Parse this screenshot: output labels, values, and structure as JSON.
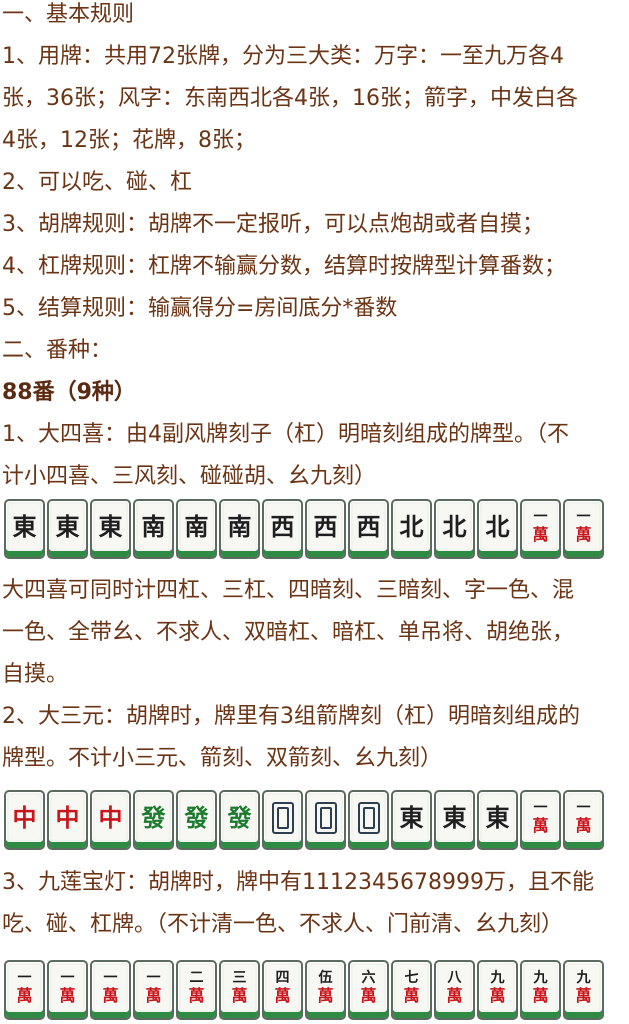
{
  "text_lines": [
    "一、基本规则",
    "1、用牌：共用72张牌，分为三大类：万字：一至九万各4",
    "张，36张；风字：东南西北各4张，16张；箭字，中发白各",
    "4张，12张；花牌，8张；",
    "2、可以吃、碰、杠",
    "3、胡牌规则：胡牌不一定报听，可以点炮胡或者自摸；",
    "4、杠牌规则：杠牌不输赢分数，结算时按牌型计算番数；",
    "5、结算规则：输赢得分=房间底分*番数",
    "二、番种：",
    "88番（9种）",
    "1、大四喜：由4副风牌刻子（杠）明暗刻组成的牌型。（不",
    "计小四喜、三风刻、碰碰胡、幺九刻）",
    "大四喜可同时计四杠、三杠、四暗刻、三暗刻、字一色、混",
    "一色、全带幺、不求人、双暗杠、暗杠、单吊将、胡绝张，",
    "自摸。",
    "2、大三元：胡牌时，牌里有3组箭牌刻（杠）明暗刻组成的",
    "牌型。不计小三元、箭刻、双箭刻、幺九刻）",
    "3、九莲宝灯：胡牌时，牌中有1112345678999万，且不能",
    "吃、碰、杠牌。（不计清一色、不求人、门前清、幺九刻）"
  ],
  "tile_rows": [
    [
      {
        "kind": "char",
        "glyph": "東",
        "color": "black"
      },
      {
        "kind": "char",
        "glyph": "東",
        "color": "black"
      },
      {
        "kind": "char",
        "glyph": "東",
        "color": "black"
      },
      {
        "kind": "char",
        "glyph": "南",
        "color": "black"
      },
      {
        "kind": "char",
        "glyph": "南",
        "color": "black"
      },
      {
        "kind": "char",
        "glyph": "南",
        "color": "black"
      },
      {
        "kind": "char",
        "glyph": "西",
        "color": "black"
      },
      {
        "kind": "char",
        "glyph": "西",
        "color": "black"
      },
      {
        "kind": "char",
        "glyph": "西",
        "color": "black"
      },
      {
        "kind": "char",
        "glyph": "北",
        "color": "black"
      },
      {
        "kind": "char",
        "glyph": "北",
        "color": "black"
      },
      {
        "kind": "char",
        "glyph": "北",
        "color": "black"
      },
      {
        "kind": "wan",
        "num": "一",
        "wan": "萬"
      },
      {
        "kind": "wan",
        "num": "一",
        "wan": "萬"
      }
    ],
    [
      {
        "kind": "char",
        "glyph": "中",
        "color": "red"
      },
      {
        "kind": "char",
        "glyph": "中",
        "color": "red"
      },
      {
        "kind": "char",
        "glyph": "中",
        "color": "red"
      },
      {
        "kind": "char",
        "glyph": "發",
        "color": "green"
      },
      {
        "kind": "char",
        "glyph": "發",
        "color": "green"
      },
      {
        "kind": "char",
        "glyph": "發",
        "color": "green"
      },
      {
        "kind": "white"
      },
      {
        "kind": "white"
      },
      {
        "kind": "white"
      },
      {
        "kind": "char",
        "glyph": "東",
        "color": "black"
      },
      {
        "kind": "char",
        "glyph": "東",
        "color": "black"
      },
      {
        "kind": "char",
        "glyph": "東",
        "color": "black"
      },
      {
        "kind": "wan",
        "num": "一",
        "wan": "萬"
      },
      {
        "kind": "wan",
        "num": "一",
        "wan": "萬"
      }
    ],
    [
      {
        "kind": "wan",
        "num": "一",
        "wan": "萬"
      },
      {
        "kind": "wan",
        "num": "一",
        "wan": "萬"
      },
      {
        "kind": "wan",
        "num": "一",
        "wan": "萬"
      },
      {
        "kind": "wan",
        "num": "一",
        "wan": "萬"
      },
      {
        "kind": "wan",
        "num": "二",
        "wan": "萬"
      },
      {
        "kind": "wan",
        "num": "三",
        "wan": "萬"
      },
      {
        "kind": "wan",
        "num": "四",
        "wan": "萬"
      },
      {
        "kind": "wan",
        "num": "伍",
        "wan": "萬"
      },
      {
        "kind": "wan",
        "num": "六",
        "wan": "萬"
      },
      {
        "kind": "wan",
        "num": "七",
        "wan": "萬"
      },
      {
        "kind": "wan",
        "num": "八",
        "wan": "萬"
      },
      {
        "kind": "wan",
        "num": "九",
        "wan": "萬"
      },
      {
        "kind": "wan",
        "num": "九",
        "wan": "萬"
      },
      {
        "kind": "wan",
        "num": "九",
        "wan": "萬"
      }
    ]
  ],
  "colors": {
    "text": "#6b3415",
    "tile_back": "#2f8a43",
    "red": "#c8161d",
    "green": "#1c7a2e"
  }
}
